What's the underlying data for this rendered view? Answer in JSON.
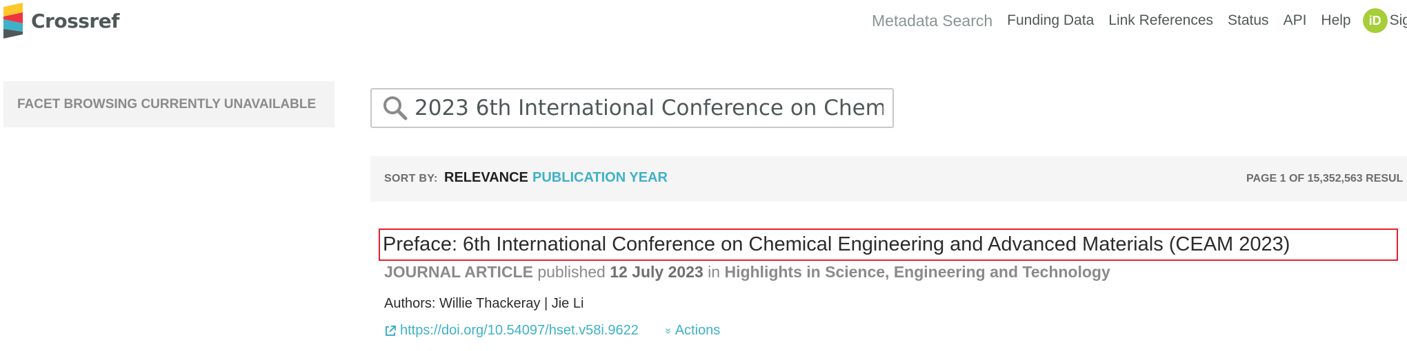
{
  "header": {
    "logo_text": "Crossref",
    "nav": [
      {
        "label": "Metadata Search"
      },
      {
        "label": "Funding Data"
      },
      {
        "label": "Link References"
      },
      {
        "label": "Status"
      },
      {
        "label": "API"
      },
      {
        "label": "Help"
      }
    ],
    "orcid_badge": "iD",
    "orcid_label": "Sig"
  },
  "sidebar": {
    "facet_notice": "FACET BROWSING CURRENTLY UNAVAILABLE"
  },
  "search": {
    "value": "2023 6th International Conference on Chem"
  },
  "sort": {
    "label": "SORT BY:",
    "options": [
      {
        "label": "RELEVANCE",
        "active": true
      },
      {
        "label": "PUBLICATION YEAR",
        "active": false
      }
    ],
    "page_info": "PAGE 1 OF 15,352,563 RESUL"
  },
  "results": [
    {
      "title": "Preface: 6th International Conference on Chemical Engineering and Advanced Materials (CEAM 2023)",
      "type": "JOURNAL ARTICLE",
      "published_word": "published",
      "date": "12 July 2023",
      "in_word": "in",
      "journal": "Highlights in Science, Engineering and Technology",
      "authors_label": "Authors:",
      "authors": "Willie Thackeray | Jie Li",
      "doi": "https://doi.org/10.54097/hset.v58i.9622",
      "actions_label": "Actions"
    }
  ],
  "colors": {
    "accent": "#3eb1c8",
    "highlight_border": "#e5202e",
    "orcid": "#a6ce39"
  },
  "icons": [
    "crossref-logo-icon",
    "search-icon",
    "external-link-icon",
    "double-chevron-down-icon",
    "orcid-icon"
  ]
}
